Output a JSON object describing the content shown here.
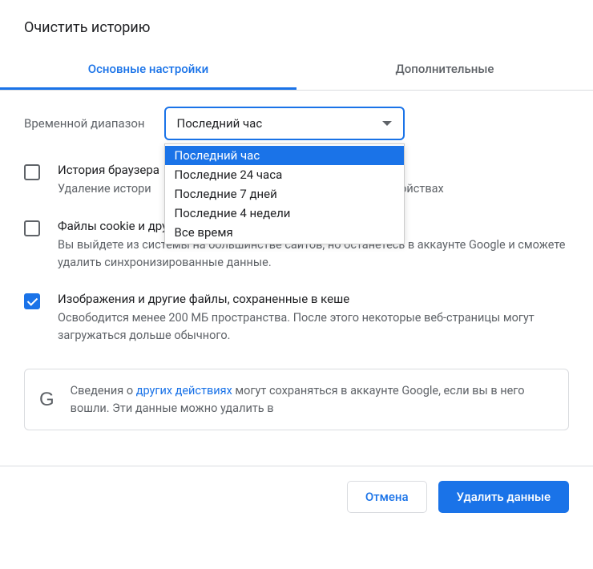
{
  "title": "Очистить историю",
  "tabs": {
    "basic": "Основные настройки",
    "advanced": "Дополнительные"
  },
  "time_range": {
    "label": "Временной диапазон",
    "selected": "Последний час",
    "options": [
      "Последний час",
      "Последние 24 часа",
      "Последние 7 дней",
      "Последние 4 недели",
      "Все время"
    ]
  },
  "items": {
    "history": {
      "checked": false,
      "title": "История браузера",
      "desc_prefix": "Удаление истори",
      "desc_suffix": "стройствах"
    },
    "cookies": {
      "checked": false,
      "title": "Файлы cookie и другие данные сайтов",
      "desc": "Вы выйдете из системы на большинстве сайтов, но останетесь в аккаунте Google и сможете удалить синхронизированные данные."
    },
    "cache": {
      "checked": true,
      "title": "Изображения и другие файлы, сохраненные в кеше",
      "desc": "Освободится менее 200 МБ пространства. После этого некоторые веб-страницы могут загружаться дольше обычного."
    }
  },
  "info": {
    "prefix": "Сведения о ",
    "link": "других действиях",
    "suffix": " могут сохраняться в аккаунте Google, если вы в него вошли. Эти данные можно удалить в"
  },
  "buttons": {
    "cancel": "Отмена",
    "confirm": "Удалить данные"
  }
}
